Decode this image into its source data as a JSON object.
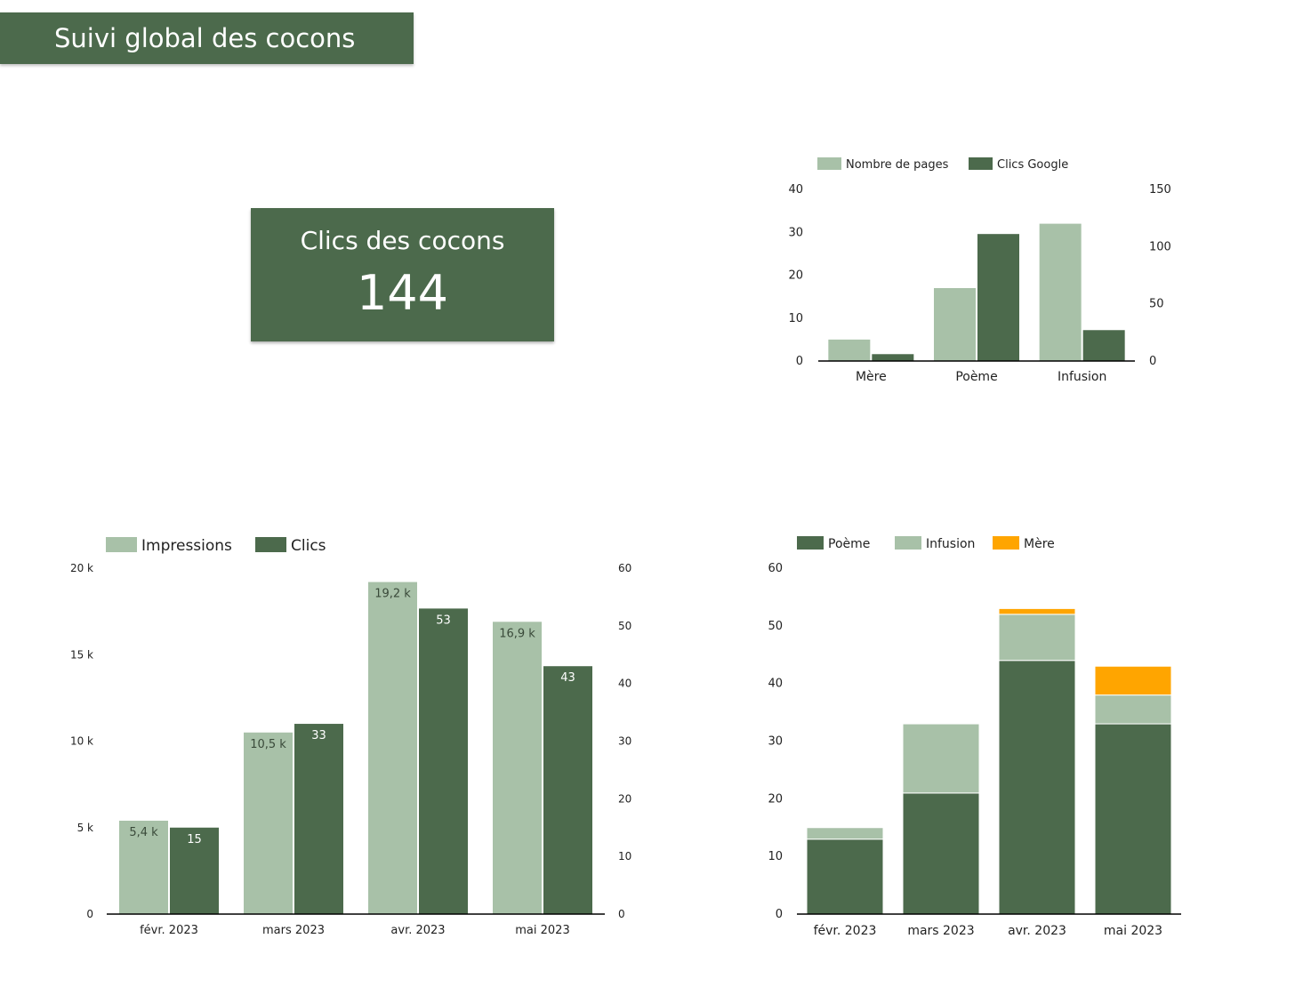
{
  "header": {
    "title": "Suivi global des cocons"
  },
  "kpi": {
    "label": "Clics des cocons",
    "value": "144"
  },
  "colors": {
    "dark_green": "#4c6a4c",
    "light_green": "#a8c1a8",
    "orange": "#ffa500",
    "header_bg": "#4c6a4c"
  },
  "chart_data": [
    {
      "id": "pages-vs-clicks",
      "type": "bar",
      "title": "",
      "categories": [
        "Mère",
        "Poème",
        "Infusion"
      ],
      "series": [
        {
          "name": "Nombre de pages",
          "axis": "left",
          "color": "#a8c1a8",
          "values": [
            5,
            17,
            32
          ]
        },
        {
          "name": "Clics Google",
          "axis": "right",
          "color": "#4c6a4c",
          "values": [
            6,
            111,
            27
          ]
        }
      ],
      "y_left": {
        "range": [
          0,
          40
        ],
        "ticks": [
          "0",
          "10",
          "20",
          "30",
          "40"
        ],
        "tick_values": [
          0,
          10,
          20,
          30,
          40
        ]
      },
      "y_right": {
        "range": [
          0,
          150
        ],
        "ticks": [
          "0",
          "50",
          "100",
          "150"
        ],
        "tick_values": [
          0,
          50,
          100,
          150
        ]
      },
      "legend": "top-left",
      "grid": false
    },
    {
      "id": "impressions-vs-clicks",
      "type": "bar",
      "title": "",
      "categories": [
        "févr. 2023",
        "mars 2023",
        "avr. 2023",
        "mai 2023"
      ],
      "series": [
        {
          "name": "Impressions",
          "axis": "left",
          "color": "#a8c1a8",
          "values": [
            5400,
            10500,
            19200,
            16900
          ],
          "labels": [
            "5,4 k",
            "10,5 k",
            "19,2 k",
            "16,9 k"
          ]
        },
        {
          "name": "Clics",
          "axis": "right",
          "color": "#4c6a4c",
          "values": [
            15,
            33,
            53,
            43
          ],
          "labels": [
            "15",
            "33",
            "53",
            "43"
          ]
        }
      ],
      "y_left": {
        "range": [
          0,
          20000
        ],
        "ticks": [
          "0",
          "5 k",
          "10 k",
          "15 k",
          "20 k"
        ],
        "tick_values": [
          0,
          5000,
          10000,
          15000,
          20000
        ]
      },
      "y_right": {
        "range": [
          0,
          60
        ],
        "ticks": [
          "0",
          "10",
          "20",
          "30",
          "40",
          "50",
          "60"
        ],
        "tick_values": [
          0,
          10,
          20,
          30,
          40,
          50,
          60
        ]
      },
      "legend": "top-left",
      "grid": false
    },
    {
      "id": "clicks-by-cocon-stacked",
      "type": "bar",
      "stacked": true,
      "title": "",
      "categories": [
        "févr. 2023",
        "mars 2023",
        "avr. 2023",
        "mai 2023"
      ],
      "series": [
        {
          "name": "Poème",
          "color": "#4c6a4c",
          "values": [
            13,
            21,
            44,
            33
          ]
        },
        {
          "name": "Infusion",
          "color": "#a8c1a8",
          "values": [
            2,
            12,
            8,
            5
          ]
        },
        {
          "name": "Mère",
          "color": "#ffa500",
          "values": [
            0,
            0,
            1,
            5
          ]
        }
      ],
      "y_left": {
        "range": [
          0,
          60
        ],
        "ticks": [
          "0",
          "10",
          "20",
          "30",
          "40",
          "50",
          "60"
        ],
        "tick_values": [
          0,
          10,
          20,
          30,
          40,
          50,
          60
        ]
      },
      "legend": "top-left",
      "grid": false
    }
  ]
}
